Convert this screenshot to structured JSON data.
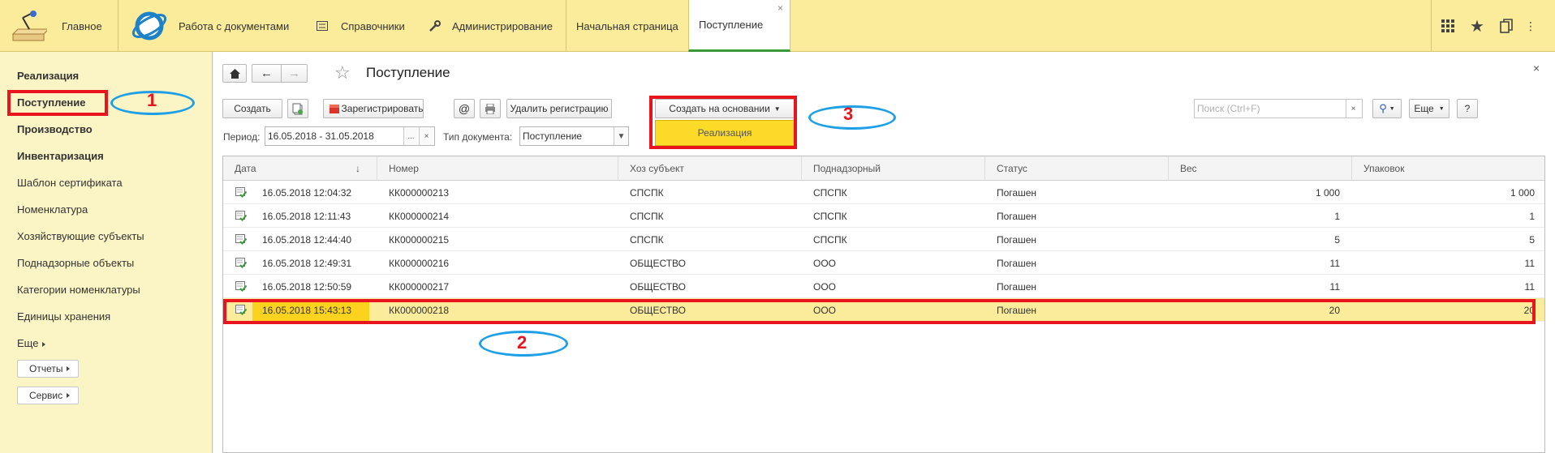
{
  "topbar": {
    "home_label": "Главное",
    "sections": [
      "Работа с документами",
      "Справочники",
      "Администрирование"
    ],
    "tabs": [
      "Начальная страница",
      "Поступление"
    ]
  },
  "sidebar": {
    "bold_items": [
      "Реализация",
      "Поступление",
      "Производство",
      "Инвентаризация"
    ],
    "items": [
      "Шаблон сертификата",
      "Номенклатура",
      "Хозяйствующие субъекты",
      "Поднадзорные объекты",
      "Категории номенклатуры",
      "Единицы хранения"
    ],
    "more": "Еще",
    "reports_btn": "Отчеты",
    "service_btn": "Сервис"
  },
  "main": {
    "title": "Поступление",
    "toolbar": {
      "create": "Создать",
      "register": "Зарегистрировать",
      "delete_registration": "Удалить регистрацию",
      "create_based_on": "Создать на основании",
      "search_placeholder": "Поиск (Ctrl+F)",
      "more": "Еще",
      "help": "?"
    },
    "filter": {
      "period_label": "Период:",
      "period_value": "16.05.2018 - 31.05.2018",
      "doc_type_label": "Тип документа:",
      "doc_type_value": "Поступление"
    },
    "popup_item": "Реализация",
    "table": {
      "columns": [
        "Дата",
        "Номер",
        "Хоз субъект",
        "Поднадзорный",
        "Статус",
        "Вес",
        "Упаковок"
      ],
      "rows": [
        [
          "16.05.2018 12:04:32",
          "КК000000213",
          "СПСПК",
          "СПСПК",
          "Погашен",
          "1 000",
          "1 000"
        ],
        [
          "16.05.2018 12:11:43",
          "КК000000214",
          "СПСПК",
          "СПСПК",
          "Погашен",
          "1",
          "1"
        ],
        [
          "16.05.2018 12:44:40",
          "КК000000215",
          "СПСПК",
          "СПСПК",
          "Погашен",
          "5",
          "5"
        ],
        [
          "16.05.2018 12:49:31",
          "КК000000216",
          "ОБЩЕСТВО",
          "ООО",
          "Погашен",
          "11",
          "11"
        ],
        [
          "16.05.2018 12:50:59",
          "КК000000217",
          "ОБЩЕСТВО",
          "ООО",
          "Погашен",
          "11",
          "11"
        ],
        [
          "16.05.2018 15:43:13",
          "КК000000218",
          "ОБЩЕСТВО",
          "ООО",
          "Погашен",
          "20",
          "20"
        ]
      ],
      "selected_row": 5
    }
  },
  "annotations": [
    "1",
    "2",
    "3"
  ],
  "colors": {
    "topbar": "#fbec9c",
    "sidebar": "#fbf4c5",
    "annotation_red": "#e8141e",
    "annotation_blue": "#1ea0e6",
    "selected_row": "#fbec9c"
  }
}
